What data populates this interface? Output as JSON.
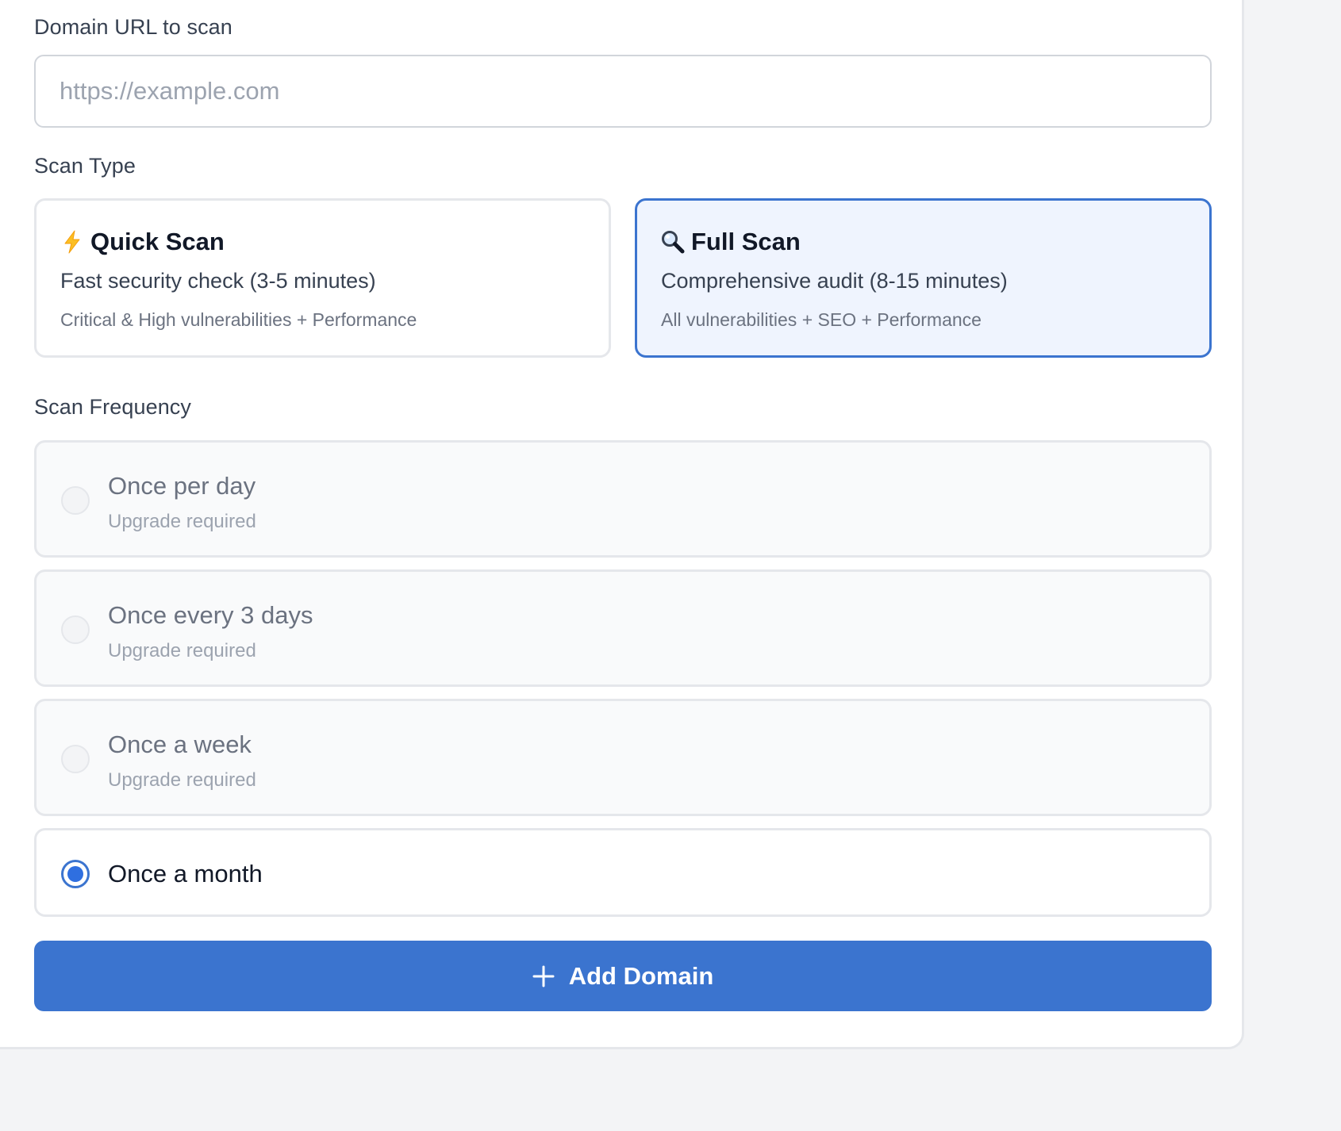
{
  "domain": {
    "label": "Domain URL to scan",
    "placeholder": "https://example.com",
    "value": ""
  },
  "scan_type": {
    "label": "Scan Type",
    "options": [
      {
        "icon": "lightning-bolt-icon",
        "title": "Quick Scan",
        "description": "Fast security check (3-5 minutes)",
        "details": "Critical & High vulnerabilities + Performance",
        "selected": false
      },
      {
        "icon": "magnifying-glass-icon",
        "title": "Full Scan",
        "description": "Comprehensive audit (8-15 minutes)",
        "details": "All vulnerabilities + SEO + Performance",
        "selected": true
      }
    ]
  },
  "frequency": {
    "label": "Scan Frequency",
    "options": [
      {
        "label": "Once per day",
        "note": "Upgrade required",
        "enabled": false,
        "selected": false
      },
      {
        "label": "Once every 3 days",
        "note": "Upgrade required",
        "enabled": false,
        "selected": false
      },
      {
        "label": "Once a week",
        "note": "Upgrade required",
        "enabled": false,
        "selected": false
      },
      {
        "label": "Once a month",
        "note": "",
        "enabled": true,
        "selected": true
      }
    ]
  },
  "submit": {
    "label": "Add Domain",
    "icon": "plus-icon"
  },
  "colors": {
    "accent": "#3b74cf",
    "selected_card_bg": "#eff4fe",
    "disabled_option_bg": "#f9fafb"
  }
}
